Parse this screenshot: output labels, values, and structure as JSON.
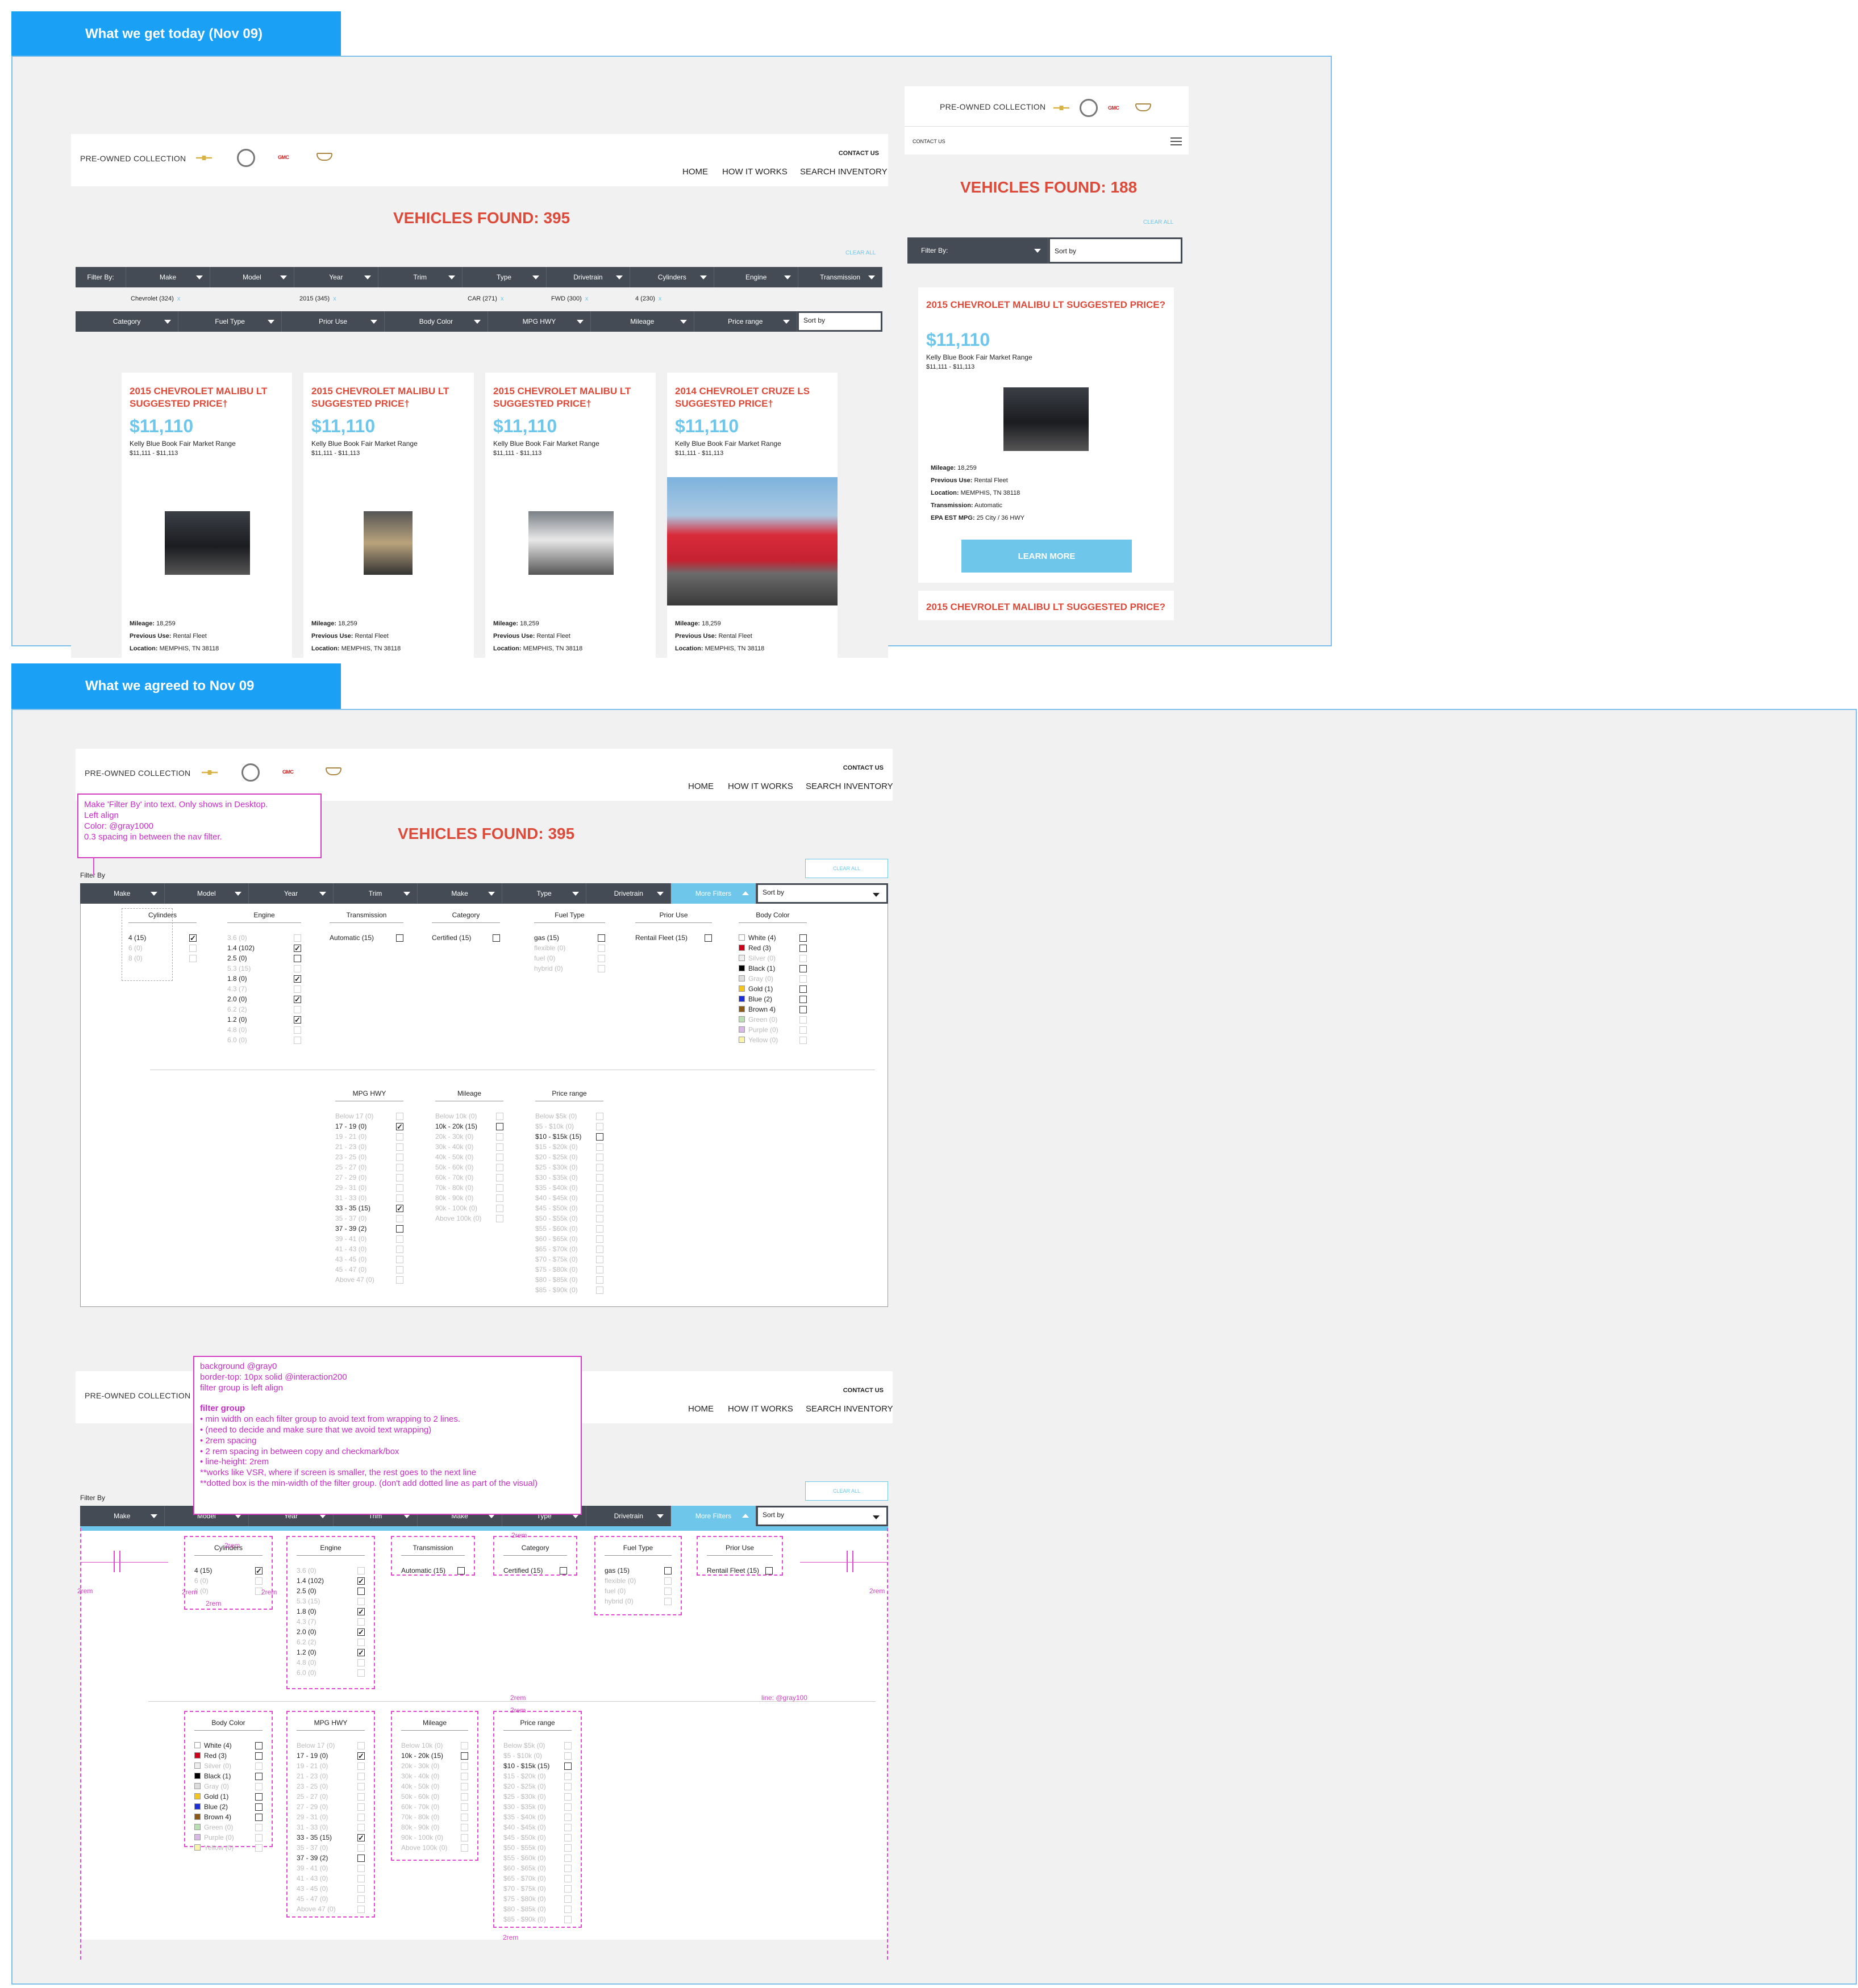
{
  "sections": {
    "today_label": "What we get today (Nov 09)",
    "agreed_label": "What we agreed to Nov 09"
  },
  "brand": {
    "collection": "PRE-OWNED COLLECTION",
    "contact": "CONTACT US",
    "nav": [
      "HOME",
      "HOW IT WORKS",
      "SEARCH INVENTORY"
    ],
    "gmc": "GMC"
  },
  "colors": {
    "accent": "#1aa0f5",
    "red": "#dc4a3a",
    "teal": "#6ec7ea",
    "bar": "#444b54",
    "annotation": "#d43fc3"
  },
  "desktop": {
    "found": "VEHICLES FOUND: 395",
    "clear_all": "CLEAR ALL",
    "filter_by": "Filter By:",
    "filters1": [
      "Make",
      "Model",
      "Year",
      "Trim",
      "Type",
      "Drivetrain",
      "Cylinders",
      "Engine",
      "Transmission"
    ],
    "chips": [
      "Chevrolet  (324)",
      "2015  (345)",
      "CAR  (271)",
      "FWD  (300)",
      "4  (230)"
    ],
    "chip_x": "x",
    "filters2": [
      "Category",
      "Fuel Type",
      "Prior Use",
      "Body Color",
      "MPG HWY",
      "Mileage",
      "Price range"
    ],
    "sort": "Sort by",
    "cards": [
      {
        "title": "2015 CHEVROLET MALIBU LT SUGGESTED PRICE†",
        "price": "$11,110",
        "kbb": "Kelly Blue Book Fair Market Range",
        "range": "$11,111 - $11,113",
        "mileage_label": "Mileage:",
        "mileage": "18,259",
        "use_label": "Previous Use:",
        "use": "Rental Fleet",
        "loc_label": "Location:",
        "loc": "MEMPHIS, TN 38118"
      },
      {
        "title": "2015 CHEVROLET MALIBU LT SUGGESTED PRICE†",
        "price": "$11,110",
        "kbb": "Kelly Blue Book Fair Market Range",
        "range": "$11,111 - $11,113",
        "mileage_label": "Mileage:",
        "mileage": "18,259",
        "use_label": "Previous Use:",
        "use": "Rental Fleet",
        "loc_label": "Location:",
        "loc": "MEMPHIS, TN 38118"
      },
      {
        "title": "2015 CHEVROLET MALIBU LT SUGGESTED PRICE†",
        "price": "$11,110",
        "kbb": "Kelly Blue Book Fair Market Range",
        "range": "$11,111 - $11,113",
        "mileage_label": "Mileage:",
        "mileage": "18,259",
        "use_label": "Previous Use:",
        "use": "Rental Fleet",
        "loc_label": "Location:",
        "loc": "MEMPHIS, TN 38118"
      },
      {
        "title": "2014 CHEVROLET CRUZE LS SUGGESTED PRICE†",
        "price": "$11,110",
        "kbb": "Kelly Blue Book Fair Market Range",
        "range": "$11,111 - $11,113",
        "mileage_label": "Mileage:",
        "mileage": "18,259",
        "use_label": "Previous Use:",
        "use": "Rental Fleet",
        "loc_label": "Location:",
        "loc": "MEMPHIS, TN 38118"
      }
    ]
  },
  "mobile": {
    "found": "VEHICLES FOUND: 188",
    "clear_all": "CLEAR ALL",
    "filter_by": "Filter By:",
    "sort": "Sort by",
    "card": {
      "title": "2015 CHEVROLET MALIBU LT SUGGESTED PRICE?",
      "price": "$11,110",
      "kbb": "Kelly Blue Book Fair Market Range",
      "range": "$11,111 - $11,113",
      "mileage_label": "Mileage:",
      "mileage": "18,259",
      "use_label": "Previous Use:",
      "use": "Rental Fleet",
      "loc_label": "Location:",
      "loc": "MEMPHIS, TN 38118",
      "trans_label": "Transmission:",
      "trans": "Automatic",
      "epa_label": "EPA EST MPG:",
      "epa": "25 City / 36 HWY",
      "cta": "LEARN MORE"
    },
    "card2_title": "2015 CHEVROLET MALIBU LT SUGGESTED PRICE?"
  },
  "agreed": {
    "found": "VEHICLES FOUND: 395",
    "clear_all": "CLEAR ALL",
    "filter_by": "Filter By",
    "filters": [
      "Make",
      "Model",
      "Year",
      "Trim",
      "Make",
      "Type",
      "Drivetrain"
    ],
    "more": "More Filters",
    "sort": "Sort by",
    "note1": [
      "Make 'Filter By' into text. Only shows in Desktop.",
      "Left align",
      "Color: @gray1000",
      "0.3 spacing in between the nav filter."
    ],
    "note2": [
      "background @gray0",
      "border-top: 10px solid @interaction200",
      "filter group is left align",
      "",
      "filter group",
      "• min width on each filter group to avoid text from wrapping to 2 lines.",
      "• (need to decide and make sure that we avoid text wrapping)",
      "• 2rem spacing",
      "• 2 rem spacing in between copy and checkmark/box",
      "• line-height:  2rem",
      "**works like VSR, where if screen is smaller, the rest goes to the next line",
      "**dotted box is the min-width of the filter group. (don't add dotted line as part of the visual)"
    ],
    "rem": "2rem",
    "line_note": "line: @gray100"
  },
  "groups": {
    "cylinders": {
      "title": "Cylinders",
      "rows": [
        {
          "l": "4  (15)",
          "c": true,
          "d": false
        },
        {
          "l": "6  (0)",
          "c": false,
          "d": true
        },
        {
          "l": "8  (0)",
          "c": false,
          "d": true
        }
      ]
    },
    "engine": {
      "title": "Engine",
      "rows": [
        {
          "l": "3.6  (0)",
          "c": false,
          "d": true
        },
        {
          "l": "1.4  (102)",
          "c": true,
          "d": false
        },
        {
          "l": "2.5  (0)",
          "c": false,
          "d": false
        },
        {
          "l": "5.3  (15)",
          "c": false,
          "d": true
        },
        {
          "l": "1.8  (0)",
          "c": true,
          "d": false
        },
        {
          "l": "4.3  (7)",
          "c": false,
          "d": true
        },
        {
          "l": "2.0  (0)",
          "c": true,
          "d": false
        },
        {
          "l": "6.2  (2)",
          "c": false,
          "d": true
        },
        {
          "l": "1.2  (0)",
          "c": true,
          "d": false
        },
        {
          "l": "4.8  (0)",
          "c": false,
          "d": true
        },
        {
          "l": "6.0  (0)",
          "c": false,
          "d": true
        }
      ]
    },
    "transmission": {
      "title": "Transmission",
      "rows": [
        {
          "l": "Automatic  (15)",
          "c": false,
          "d": false
        }
      ]
    },
    "category": {
      "title": "Category",
      "rows": [
        {
          "l": "Certified  (15)",
          "c": false,
          "d": false
        }
      ]
    },
    "fuel": {
      "title": "Fuel Type",
      "rows": [
        {
          "l": "gas  (15)",
          "c": false,
          "d": false
        },
        {
          "l": "flexible  (0)",
          "c": false,
          "d": true
        },
        {
          "l": "fuel  (0)",
          "c": false,
          "d": true
        },
        {
          "l": "hybrid  (0)",
          "c": false,
          "d": true
        }
      ]
    },
    "prior": {
      "title": "Prior Use",
      "rows": [
        {
          "l": "Rentail Fleet  (15)",
          "c": false,
          "d": false
        }
      ]
    },
    "color": {
      "title": "Body Color",
      "rows": [
        {
          "l": "White  (4)",
          "c": false,
          "d": false,
          "s": "#ffffff"
        },
        {
          "l": "Red  (3)",
          "c": false,
          "d": false,
          "s": "#d0021b"
        },
        {
          "l": "Silver  (0)",
          "c": false,
          "d": true,
          "s": "#eeeeee"
        },
        {
          "l": "Black  (1)",
          "c": false,
          "d": false,
          "s": "#000000"
        },
        {
          "l": "Gray  (0)",
          "c": false,
          "d": true,
          "s": "#dddddd"
        },
        {
          "l": "Gold  (1)",
          "c": false,
          "d": false,
          "s": "#f5c518"
        },
        {
          "l": "Blue  (2)",
          "c": false,
          "d": false,
          "s": "#1c2fd8"
        },
        {
          "l": "Brown  4)",
          "c": false,
          "d": false,
          "s": "#8b5a14"
        },
        {
          "l": "Green  (0)",
          "c": false,
          "d": true,
          "s": "#b8e0b0"
        },
        {
          "l": "Purple  (0)",
          "c": false,
          "d": true,
          "s": "#d7b8e6"
        },
        {
          "l": "Yellow  (0)",
          "c": false,
          "d": true,
          "s": "#fbf4a8"
        }
      ]
    },
    "mpg": {
      "title": "MPG HWY",
      "rows": [
        {
          "l": "Below 17  (0)",
          "c": false,
          "d": true
        },
        {
          "l": "17 - 19  (0)",
          "c": true,
          "d": false
        },
        {
          "l": "19 - 21  (0)",
          "c": false,
          "d": true
        },
        {
          "l": "21 - 23  (0)",
          "c": false,
          "d": true
        },
        {
          "l": "23 - 25  (0)",
          "c": false,
          "d": true
        },
        {
          "l": "25 - 27  (0)",
          "c": false,
          "d": true
        },
        {
          "l": "27 - 29  (0)",
          "c": false,
          "d": true
        },
        {
          "l": "29 - 31  (0)",
          "c": false,
          "d": true
        },
        {
          "l": "31 - 33  (0)",
          "c": false,
          "d": true
        },
        {
          "l": "33 - 35  (15)",
          "c": true,
          "d": false
        },
        {
          "l": "35 - 37  (0)",
          "c": false,
          "d": true
        },
        {
          "l": "37 - 39  (2)",
          "c": false,
          "d": false
        },
        {
          "l": "39 - 41  (0)",
          "c": false,
          "d": true
        },
        {
          "l": "41 - 43  (0)",
          "c": false,
          "d": true
        },
        {
          "l": "43 - 45  (0)",
          "c": false,
          "d": true
        },
        {
          "l": "45 - 47  (0)",
          "c": false,
          "d": true
        },
        {
          "l": "Above 47  (0)",
          "c": false,
          "d": true
        }
      ]
    },
    "mileage": {
      "title": "Mileage",
      "rows": [
        {
          "l": "Below 10k  (0)",
          "c": false,
          "d": true
        },
        {
          "l": "10k - 20k  (15)",
          "c": false,
          "d": false
        },
        {
          "l": "20k - 30k  (0)",
          "c": false,
          "d": true
        },
        {
          "l": "30k - 40k  (0)",
          "c": false,
          "d": true
        },
        {
          "l": "40k - 50k  (0)",
          "c": false,
          "d": true
        },
        {
          "l": "50k - 60k  (0)",
          "c": false,
          "d": true
        },
        {
          "l": "60k - 70k  (0)",
          "c": false,
          "d": true
        },
        {
          "l": "70k - 80k  (0)",
          "c": false,
          "d": true
        },
        {
          "l": "80k - 90k  (0)",
          "c": false,
          "d": true
        },
        {
          "l": "90k - 100k  (0)",
          "c": false,
          "d": true
        },
        {
          "l": "Above 100k  (0)",
          "c": false,
          "d": true
        }
      ]
    },
    "price": {
      "title": "Price range",
      "rows": [
        {
          "l": "Below $5k  (0)",
          "c": false,
          "d": true
        },
        {
          "l": "$5 - $10k  (0)",
          "c": false,
          "d": true
        },
        {
          "l": "$10 - $15k  (15)",
          "c": false,
          "d": false
        },
        {
          "l": "$15 - $20k  (0)",
          "c": false,
          "d": true
        },
        {
          "l": "$20 - $25k  (0)",
          "c": false,
          "d": true
        },
        {
          "l": "$25 - $30k  (0)",
          "c": false,
          "d": true
        },
        {
          "l": "$30 - $35k  (0)",
          "c": false,
          "d": true
        },
        {
          "l": "$35 - $40k  (0)",
          "c": false,
          "d": true
        },
        {
          "l": "$40 - $45k  (0)",
          "c": false,
          "d": true
        },
        {
          "l": "$45 - $50k  (0)",
          "c": false,
          "d": true
        },
        {
          "l": "$50 - $55k  (0)",
          "c": false,
          "d": true
        },
        {
          "l": "$55 - $60k  (0)",
          "c": false,
          "d": true
        },
        {
          "l": "$60 - $65k  (0)",
          "c": false,
          "d": true
        },
        {
          "l": "$65 - $70k  (0)",
          "c": false,
          "d": true
        },
        {
          "l": "$70 - $75k  (0)",
          "c": false,
          "d": true
        },
        {
          "l": "$75 - $80k  (0)",
          "c": false,
          "d": true
        },
        {
          "l": "$80 - $85k  (0)",
          "c": false,
          "d": true
        },
        {
          "l": "$85 - $90k  (0)",
          "c": false,
          "d": true
        }
      ]
    }
  }
}
